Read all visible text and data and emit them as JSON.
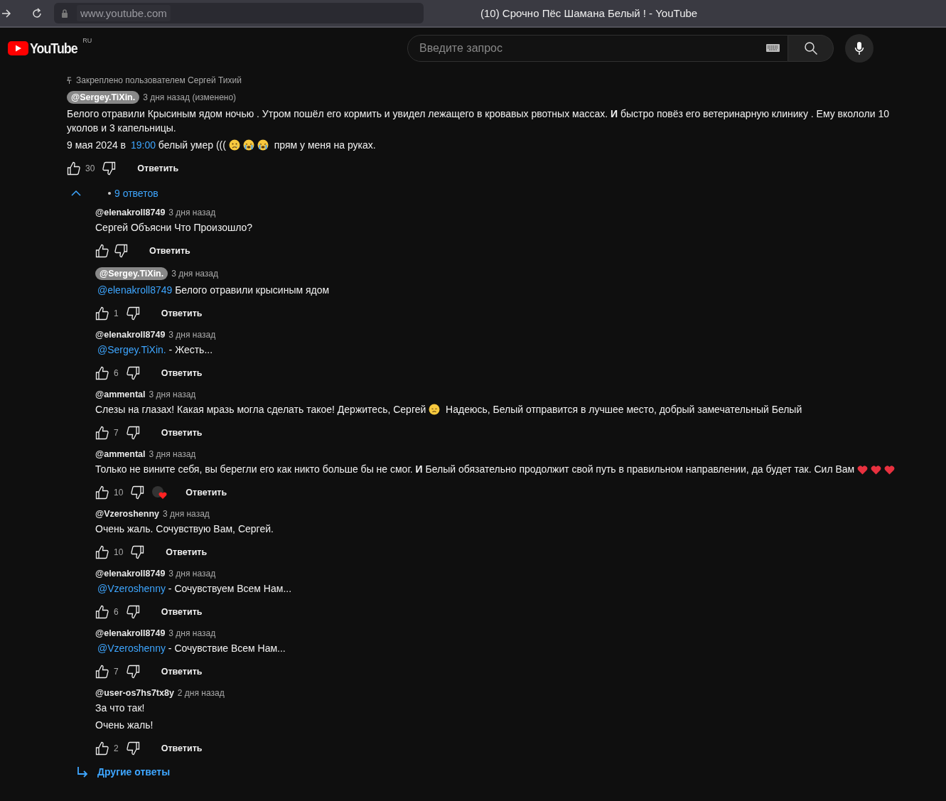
{
  "browser": {
    "url": "www.youtube.com",
    "title": "(10) Срочно Пёс Шамана Белый ! - YouTube"
  },
  "header": {
    "logo": "YouTube",
    "region": "RU",
    "search": {
      "placeholder": "Введите запрос"
    }
  },
  "pinned_comment": {
    "pinned_label": "Закреплено пользователем Сергей Тихий",
    "author": "@Sergey.TiXin.",
    "author_is_owner": true,
    "time": "3 дня назад (изменено)",
    "lines": [
      [
        {
          "kind": "text",
          "text": "Белого отравили Крысиным  ядом ночью .  Утром пошёл его кормить и увидел лежащего в кровавых рвотных массах.  **И** быстро повёз его ветеринарную клинику .   Ему вкололи 10 уколов и 3 капельницы."
        }
      ],
      [
        {
          "kind": "text",
          "text": "9 мая 2024  в "
        },
        {
          "kind": "link",
          "text": "19:00"
        },
        {
          "kind": "text",
          "text": " белый умер ((( "
        },
        {
          "kind": "tear-face"
        },
        {
          "kind": "crying-face"
        },
        {
          "kind": "crying-face"
        },
        {
          "kind": "text",
          "text": "  прям у меня на руках."
        }
      ]
    ],
    "likes": "30",
    "reply_label": "Ответить"
  },
  "replies_toggle": {
    "expanded": true,
    "label": "9 ответов"
  },
  "replies": [
    {
      "author": "@elenakroll8749",
      "author_is_owner": false,
      "time": "3 дня назад",
      "lines": [
        [
          {
            "kind": "text",
            "text": "Сергей Объясни Что Произошло?"
          }
        ]
      ],
      "reply_label": "Ответить",
      "hearted": false
    },
    {
      "author": "@Sergey.TiXin.",
      "author_is_owner": true,
      "time": "3 дня назад",
      "lines": [
        [
          {
            "kind": "link",
            "text": "@elenakroll8749"
          },
          {
            "kind": "text",
            "text": "  Белого отравили крысиным ядом"
          }
        ]
      ],
      "likes": "1",
      "reply_label": "Ответить",
      "hearted": false
    },
    {
      "author": "@elenakroll8749",
      "author_is_owner": false,
      "time": "3 дня назад",
      "lines": [
        [
          {
            "kind": "link",
            "text": "@Sergey.TiXin."
          },
          {
            "kind": "text",
            "text": "  - Жесть..."
          }
        ]
      ],
      "likes": "6",
      "reply_label": "Ответить",
      "hearted": false
    },
    {
      "author": "@ammental",
      "author_is_owner": false,
      "time": "3 дня назад",
      "lines": [
        [
          {
            "kind": "text",
            "text": "Слезы на глазах! Какая мразь могла сделать такое! Держитесь, Сергей "
          },
          {
            "kind": "sad-face"
          },
          {
            "kind": "text",
            "text": " Надеюсь, Белый отправится в лучшее место, добрый замечательный Белый"
          }
        ]
      ],
      "likes": "7",
      "reply_label": "Ответить",
      "hearted": false
    },
    {
      "author": "@ammental",
      "author_is_owner": false,
      "time": "3 дня назад",
      "lines": [
        [
          {
            "kind": "text",
            "text": "Только не вините себя, вы берегли его как никто больше бы не смог. **И** Белый обязательно продолжит свой путь в правильном направлении, да будет так. Сил Вам "
          },
          {
            "kind": "heart"
          },
          {
            "kind": "heart"
          },
          {
            "kind": "heart"
          }
        ]
      ],
      "likes": "10",
      "reply_label": "Ответить",
      "hearted": true
    },
    {
      "author": "@Vzeroshenny",
      "author_is_owner": false,
      "time": "3 дня назад",
      "lines": [
        [
          {
            "kind": "text",
            "text": "Очень жаль. Сочувствую Вам, Сергей."
          }
        ]
      ],
      "likes": "10",
      "reply_label": "Ответить",
      "hearted": false
    },
    {
      "author": "@elenakroll8749",
      "author_is_owner": false,
      "time": "3 дня назад",
      "lines": [
        [
          {
            "kind": "link",
            "text": "@Vzeroshenny"
          },
          {
            "kind": "text",
            "text": "  - Сочувствуем Всем Нам..."
          }
        ]
      ],
      "likes": "6",
      "reply_label": "Ответить",
      "hearted": false
    },
    {
      "author": "@elenakroll8749",
      "author_is_owner": false,
      "time": "3 дня назад",
      "lines": [
        [
          {
            "kind": "link",
            "text": "@Vzeroshenny"
          },
          {
            "kind": "text",
            "text": "  - Сочувствие Всем Нам..."
          }
        ]
      ],
      "likes": "7",
      "reply_label": "Ответить",
      "hearted": false
    },
    {
      "author": "@user-os7hs7tx8y",
      "author_is_owner": false,
      "time": "2 дня назад",
      "lines": [
        [
          {
            "kind": "text",
            "text": "За что так!"
          }
        ],
        [
          {
            "kind": "text",
            "text": "Очень жаль!"
          }
        ]
      ],
      "likes": "2",
      "reply_label": "Ответить",
      "hearted": false
    }
  ],
  "more_replies": {
    "label": "Другие ответы"
  }
}
